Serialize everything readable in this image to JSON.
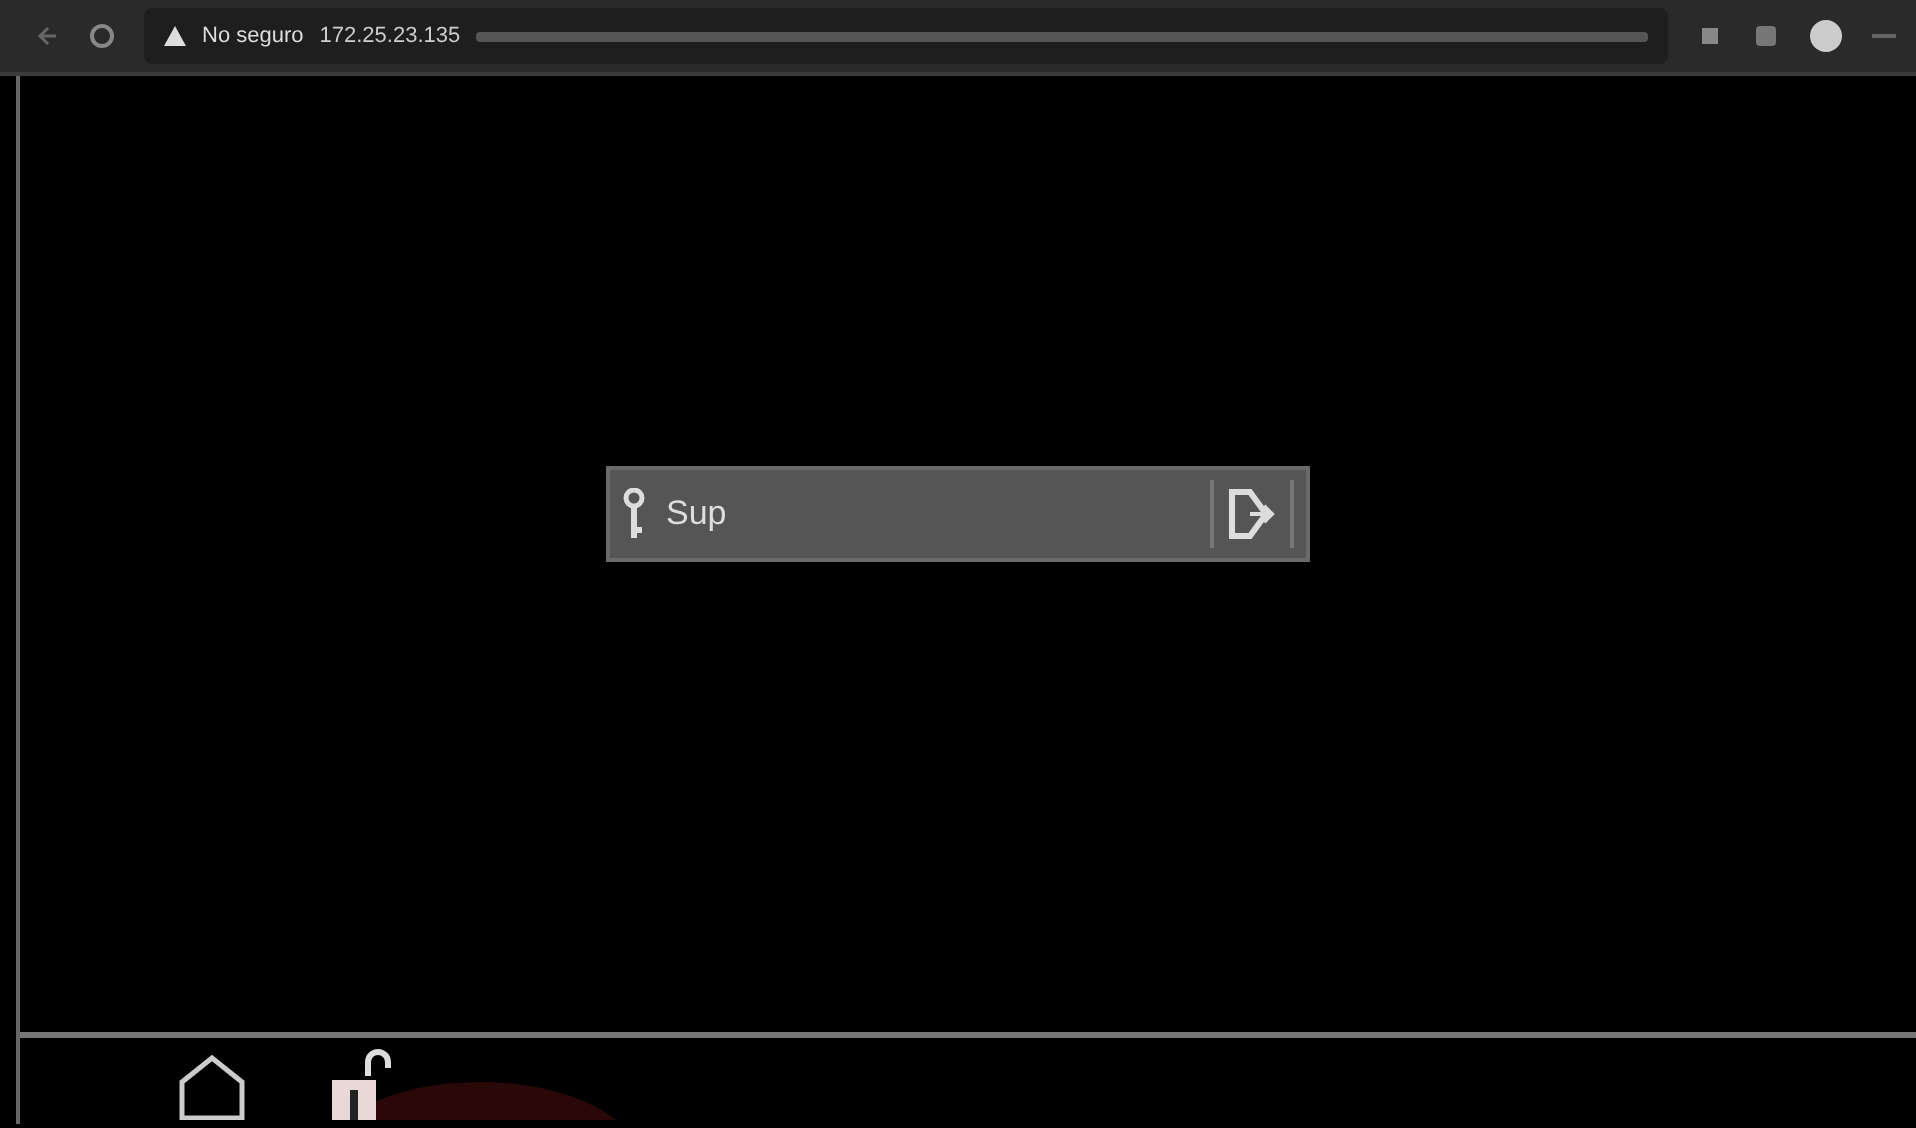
{
  "browser": {
    "security_label": "No seguro",
    "url": "172.25.23.135"
  },
  "login": {
    "user": "Sup"
  }
}
